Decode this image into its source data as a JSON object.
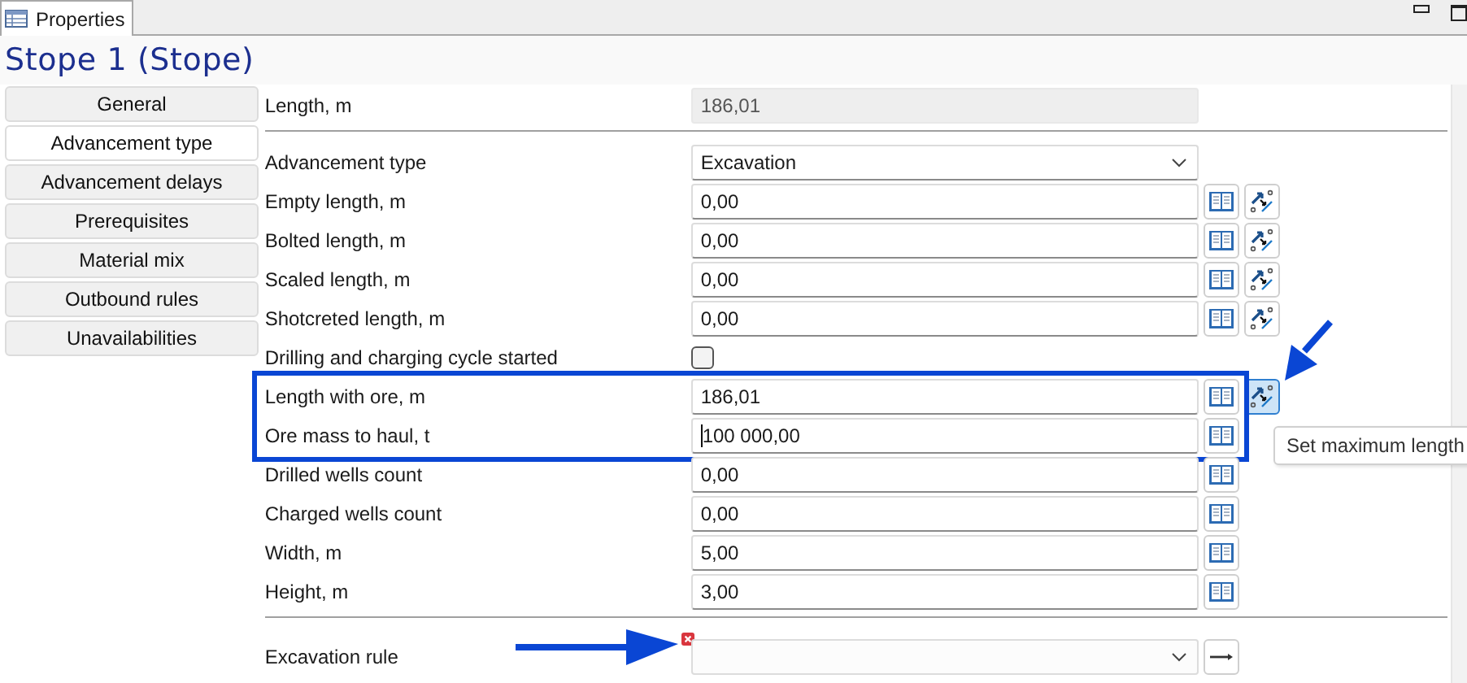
{
  "tab": {
    "label": "Properties",
    "selected": true
  },
  "title": "Stope 1 (Stope)",
  "nav": {
    "items": [
      {
        "label": "General",
        "selected": false
      },
      {
        "label": "Advancement type",
        "selected": true
      },
      {
        "label": "Advancement delays",
        "selected": false
      },
      {
        "label": "Prerequisites",
        "selected": false
      },
      {
        "label": "Material mix",
        "selected": false
      },
      {
        "label": "Outbound rules",
        "selected": false
      },
      {
        "label": "Unavailabilities",
        "selected": false
      }
    ]
  },
  "sections": [
    {
      "rows": [
        {
          "kind": "readonly",
          "label": "Length, m",
          "value": "186,01"
        }
      ]
    },
    {
      "divider_before": true,
      "rows": [
        {
          "kind": "dropdown",
          "label": "Advancement type",
          "value": "Excavation"
        },
        {
          "kind": "number",
          "label": "Empty length, m",
          "value": "0,00",
          "book": true,
          "max_button": true
        },
        {
          "kind": "number",
          "label": "Bolted length, m",
          "value": "0,00",
          "book": true,
          "max_button": true
        },
        {
          "kind": "number",
          "label": "Scaled length, m",
          "value": "0,00",
          "book": true,
          "max_button": true
        },
        {
          "kind": "number",
          "label": "Shotcreted length, m",
          "value": "0,00",
          "book": true,
          "max_button": true
        },
        {
          "kind": "checkbox",
          "label": "Drilling and charging cycle started",
          "checked": false
        }
      ]
    },
    {
      "highlighted": true,
      "rows": [
        {
          "kind": "number",
          "label": "Length with ore, m",
          "value": "186,01",
          "book": true,
          "max_button": true,
          "hovered": true
        },
        {
          "kind": "number",
          "label": "Ore mass to haul, t",
          "value": "100 000,00",
          "book": true,
          "focused": true
        }
      ]
    },
    {
      "rows": [
        {
          "kind": "number",
          "label": "Drilled wells count",
          "value": "0,00",
          "book": true
        },
        {
          "kind": "number",
          "label": "Charged wells count",
          "value": "0,00",
          "book": true
        },
        {
          "kind": "number",
          "label": "Width, m",
          "value": "5,00",
          "book": true
        },
        {
          "kind": "number",
          "label": "Height, m",
          "value": "3,00",
          "book": true
        }
      ]
    },
    {
      "divider_before": true,
      "rows": [
        {
          "kind": "combo",
          "label": "Excavation rule",
          "error": true
        }
      ]
    }
  ],
  "tooltip": "Set maximum length"
}
